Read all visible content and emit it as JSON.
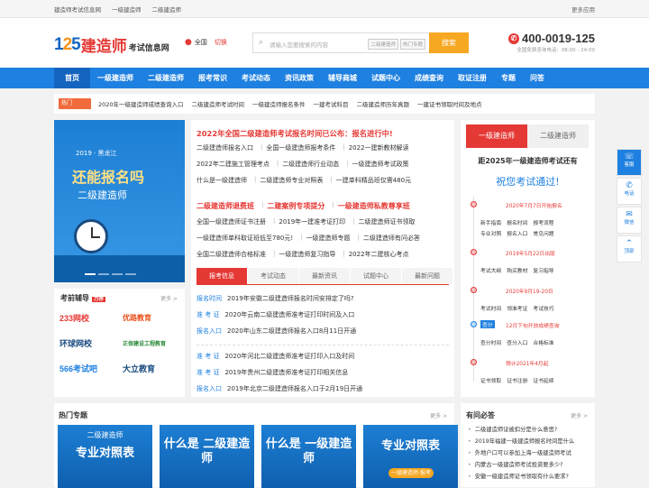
{
  "topbar": {
    "links": [
      "建造师考试信息网",
      "一级建造师",
      "二级建造师"
    ],
    "right": "更多应用"
  },
  "logo": {
    "num_a": "1",
    "num_b": "2",
    "num_c": "5",
    "t1": "建造师",
    "t2": "考试信息网"
  },
  "location": {
    "city": "全国",
    "switch": "切换"
  },
  "search": {
    "placeholder": "请输入您要搜索的内容",
    "tag1": "二级建造师",
    "tag2": "热门专题",
    "button": "搜索"
  },
  "phone": {
    "number": "400-0019-125",
    "sub": "全国免费咨询电话：08:00 - 24:00"
  },
  "nav": [
    "首页",
    "一级建造师",
    "二级建造师",
    "报考常识",
    "考试动态",
    "资讯政策",
    "辅导商城",
    "试题中心",
    "成绩查询",
    "取证注册",
    "专题",
    "问答"
  ],
  "ticker": {
    "label": "热门",
    "items": [
      "2020年一级建造师成绩查询入口",
      "二级建造师考试时间",
      "一级建造师报名条件",
      "一建考试科目",
      "二级建造师历年真题",
      "一建证书领取时间及地点"
    ]
  },
  "banner": {
    "year": "2019 · 黑龙江",
    "line1": "还能报名吗",
    "line2": "二级建造师"
  },
  "tutor": {
    "title": "考前辅导",
    "badge": "力荐",
    "more": "更多 >",
    "items": [
      "233网校",
      "优路教育",
      "环球网校",
      "正保建设工程教育",
      "566考试吧",
      "大立教育"
    ]
  },
  "news": {
    "headline": "2022年全国二级建造师考试报名时间已公布：报名进行中!",
    "rows": [
      [
        "二级建造师报名入口",
        "全国一级建造师报考条件",
        "2022一建新教材解读"
      ],
      [
        "2022年二建施工管理考点",
        "二级建造师行业动态",
        "一级建造师考试政策"
      ],
      [
        "什么是一级建造师",
        "二级建造师专业对照表",
        "一建单科精品班仅需480元"
      ]
    ],
    "red_row": [
      "二级建造师退费班",
      "二建案例专项提分",
      "一级建造师私教尊享班"
    ],
    "rows2": [
      [
        "全国一级建造师证书注册",
        "2019年一建准考证打印",
        "二级建造师证书领取"
      ],
      [
        "一级建造师单科取证班低至780元!",
        "一级建造师专题",
        "二级建造师有问必答"
      ],
      [
        "全国二级建造师合格标准",
        "一级建造师复习指导",
        "2022年二建核心考点"
      ]
    ],
    "tabs": [
      "报考信息",
      "考试动态",
      "最新资讯",
      "试题中心",
      "最新问题"
    ],
    "info": [
      {
        "k": "报名时间",
        "v": "2019年安徽二级建造师报名时间安排定了吗?"
      },
      {
        "k": "准 考 证",
        "v": "2020年云南二级建造师准考证打印时间及入口"
      },
      {
        "k": "报名入口",
        "v": "2020年山东二级建造师报名入口8月11日开通"
      },
      {
        "k": "准 考 证",
        "v": "2020年河北二级建造师准考证打印入口及时间"
      },
      {
        "k": "准 考 证",
        "v": "2019年贵州二级建造师准考证打印相关信息"
      },
      {
        "k": "报名入口",
        "v": "2019年北京二级建造师报名入口于2月19日开通"
      }
    ]
  },
  "side": {
    "tabs": [
      "一级建造师",
      "二级建造师"
    ],
    "countdown": "距2025年一级建造师考试还有",
    "wish": "祝您考试通过!",
    "timeline": [
      {
        "date": "2020年7月7日开始报名",
        "links": [
          "新手指南",
          "报名时间",
          "报考流程",
          "专业对照",
          "报名入口",
          "常见问题"
        ]
      },
      {
        "date": "2019年5月22日出版",
        "links": [
          "考试大纲",
          "购买教材",
          "复习指导"
        ]
      },
      {
        "date": "2020年9月19-20日",
        "links": [
          "考试时间",
          "领准考证",
          "考试技巧"
        ]
      },
      {
        "tag": "查分",
        "date": "12月下旬开放成绩查询",
        "links": [
          "查分时间",
          "查分入口",
          "合格标准"
        ]
      },
      {
        "date": "预计2021年4月起",
        "links": [
          "证书领取",
          "证书注册",
          "证书延续"
        ]
      }
    ]
  },
  "rail": [
    "客服",
    "电话",
    "微信",
    "顶部"
  ],
  "topic": {
    "title": "热门专题",
    "more": "更多 >",
    "cards": [
      {
        "a": "二级建造师",
        "b": "专业对照表",
        "pill": ""
      },
      {
        "a": "",
        "b": "什么是 二级建造师",
        "pill": ""
      },
      {
        "a": "",
        "b": "什么是 一级建造师",
        "pill": ""
      },
      {
        "a": "",
        "b": "专业对照表",
        "pill": "一级建造师·报考"
      }
    ]
  },
  "faq": {
    "title": "有问必答",
    "more": "更多 >",
    "items": [
      "二级建造师证被扣分是什么意思?",
      "2019年福建一级建造师报名时间是什么",
      "外地户口可以参加上海一级建造师考试",
      "内蒙古一级建造师考试投资要多少?",
      "安徽一级建造师证书领取有什么要求?"
    ]
  },
  "colors": {
    "brand_blue": "#1e80e0",
    "accent_red": "#e53935",
    "orange": "#f7a823"
  }
}
